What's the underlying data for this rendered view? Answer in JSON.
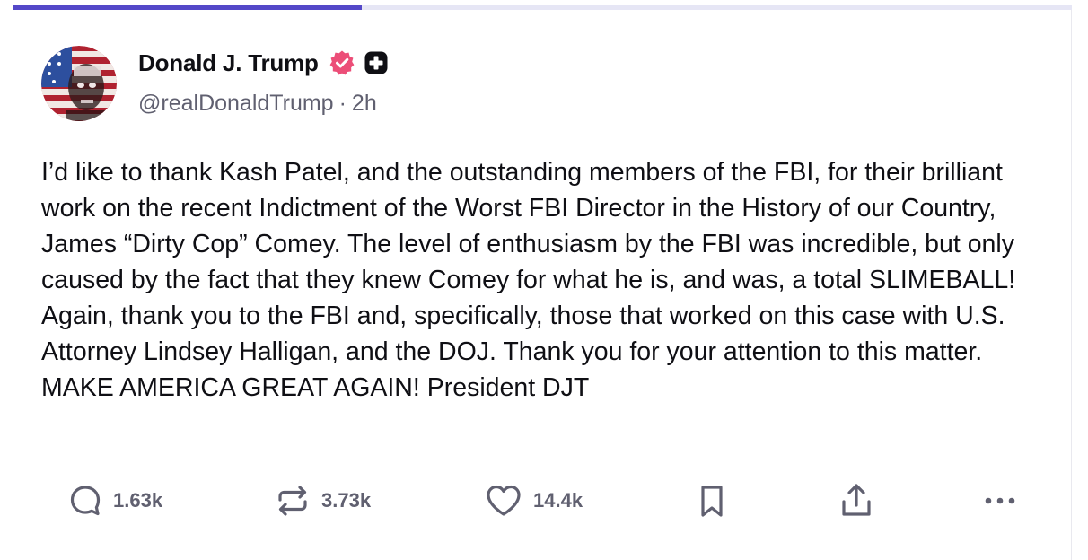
{
  "progress": {
    "fraction": 0.33,
    "fill_color": "#5448c8",
    "track_color": "#e6e6f5"
  },
  "post": {
    "author": {
      "name": "Donald J. Trump",
      "handle": "@realDonaldTrump",
      "separator": "·",
      "timestamp": "2h",
      "verified_icon": "verified-badge-icon",
      "verified_color": "#ec4e78",
      "plus_icon": "plus-badge-icon"
    },
    "text": "I’d like to thank Kash Patel, and the outstanding members of the FBI, for their brilliant work on the recent Indictment of the Worst FBI Director in the History of our Country, James “Dirty Cop” Comey. The level of enthusiasm by the FBI was incredible, but only caused by the fact that they knew Comey for what he is, and was, a total SLIMEBALL! Again, thank you to the FBI and, specifically, those that worked on this case with U.S. Attorney Lindsey Halligan, and the DOJ. Thank you for your attention to this matter. MAKE AMERICA GREAT AGAIN! President DJT",
    "actions": {
      "replies": {
        "icon": "reply-bubble-icon",
        "count": "1.63k"
      },
      "retruths": {
        "icon": "repost-arrows-icon",
        "count": "3.73k"
      },
      "likes": {
        "icon": "heart-icon",
        "count": "14.4k"
      },
      "bookmark": {
        "icon": "bookmark-icon"
      },
      "share": {
        "icon": "share-upload-icon"
      },
      "more": {
        "icon": "more-dots-icon"
      }
    }
  }
}
